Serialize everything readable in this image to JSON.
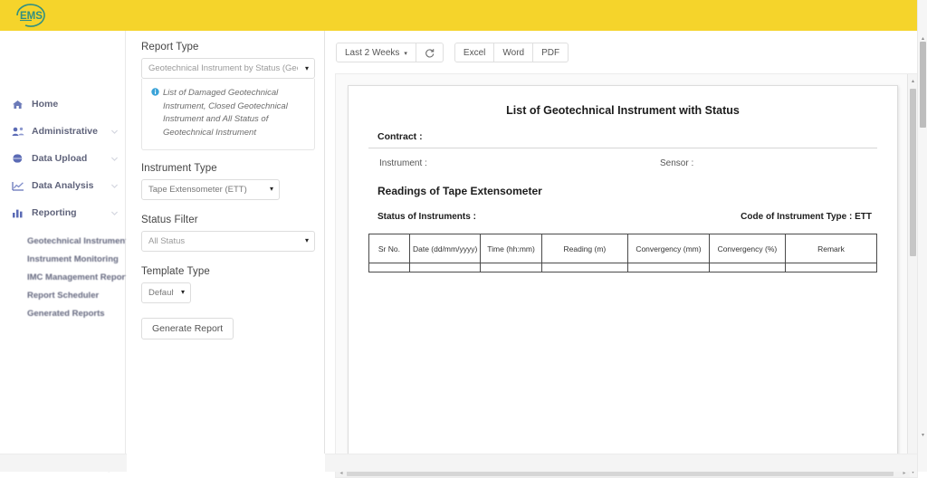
{
  "app": {
    "logo_text": "EMS",
    "brand_yellow": "#F5D42B",
    "logo_color": "#2f8f82"
  },
  "sidebar": {
    "items": [
      {
        "label": "Home",
        "icon": "home-icon",
        "expandable": false
      },
      {
        "label": "Administrative",
        "icon": "users-icon",
        "expandable": true
      },
      {
        "label": "Data Upload",
        "icon": "upload-globe-icon",
        "expandable": true
      },
      {
        "label": "Data Analysis",
        "icon": "line-chart-icon",
        "expandable": true
      },
      {
        "label": "Reporting",
        "icon": "bar-chart-icon",
        "expandable": true
      }
    ],
    "submenu": [
      "Geotechnical Instrument",
      "Instrument Monitoring",
      "IMC Management Report",
      "Report Scheduler",
      "Generated Reports"
    ],
    "collapse_icon": "chevron-left-icon"
  },
  "filters": {
    "report_type": {
      "label": "Report Type",
      "value": "Geotechnical Instrument by Status (Geotechn",
      "icon": "chevron-down-icon"
    },
    "hint": {
      "icon": "info-icon",
      "text": "List of Damaged Geotechnical Instrument, Closed Geotechnical Instrument and All Status of Geotechnical Instrument"
    },
    "instrument_type": {
      "label": "Instrument Type",
      "value": "Tape Extensometer (ETT)",
      "icon": "chevron-down-icon"
    },
    "status_filter": {
      "label": "Status Filter",
      "value": "All Status",
      "icon": "chevron-down-icon"
    },
    "template_type": {
      "label": "Template Type",
      "value": "Default",
      "icon": "chevron-down-icon"
    },
    "generate_button": "Generate Report"
  },
  "toolbar": {
    "date_range": "Last 2 Weeks",
    "date_caret": "▾",
    "refresh_icon": "refresh-icon",
    "export": [
      "Excel",
      "Word",
      "PDF"
    ]
  },
  "report": {
    "title": "List of Geotechnical Instrument with Status",
    "contract_label": "Contract  :",
    "instrument_label": "Instrument  :",
    "sensor_label": "Sensor  :",
    "readings_heading": "Readings of Tape Extensometer",
    "status_label": "Status of Instruments  :",
    "code_label": "Code of Instrument Type  : ETT",
    "table": {
      "headers": [
        "Sr No.",
        "Date (dd/mm/yyyy)",
        "Time (hh:mm)",
        "Reading (m)",
        "Convergency (mm)",
        "Convergency (%)",
        "Remark"
      ],
      "rows": []
    }
  },
  "scrollbars": {
    "vertical_up": "▴",
    "vertical_down": "▾",
    "horizontal_left": "◂",
    "horizontal_right": "▸"
  }
}
